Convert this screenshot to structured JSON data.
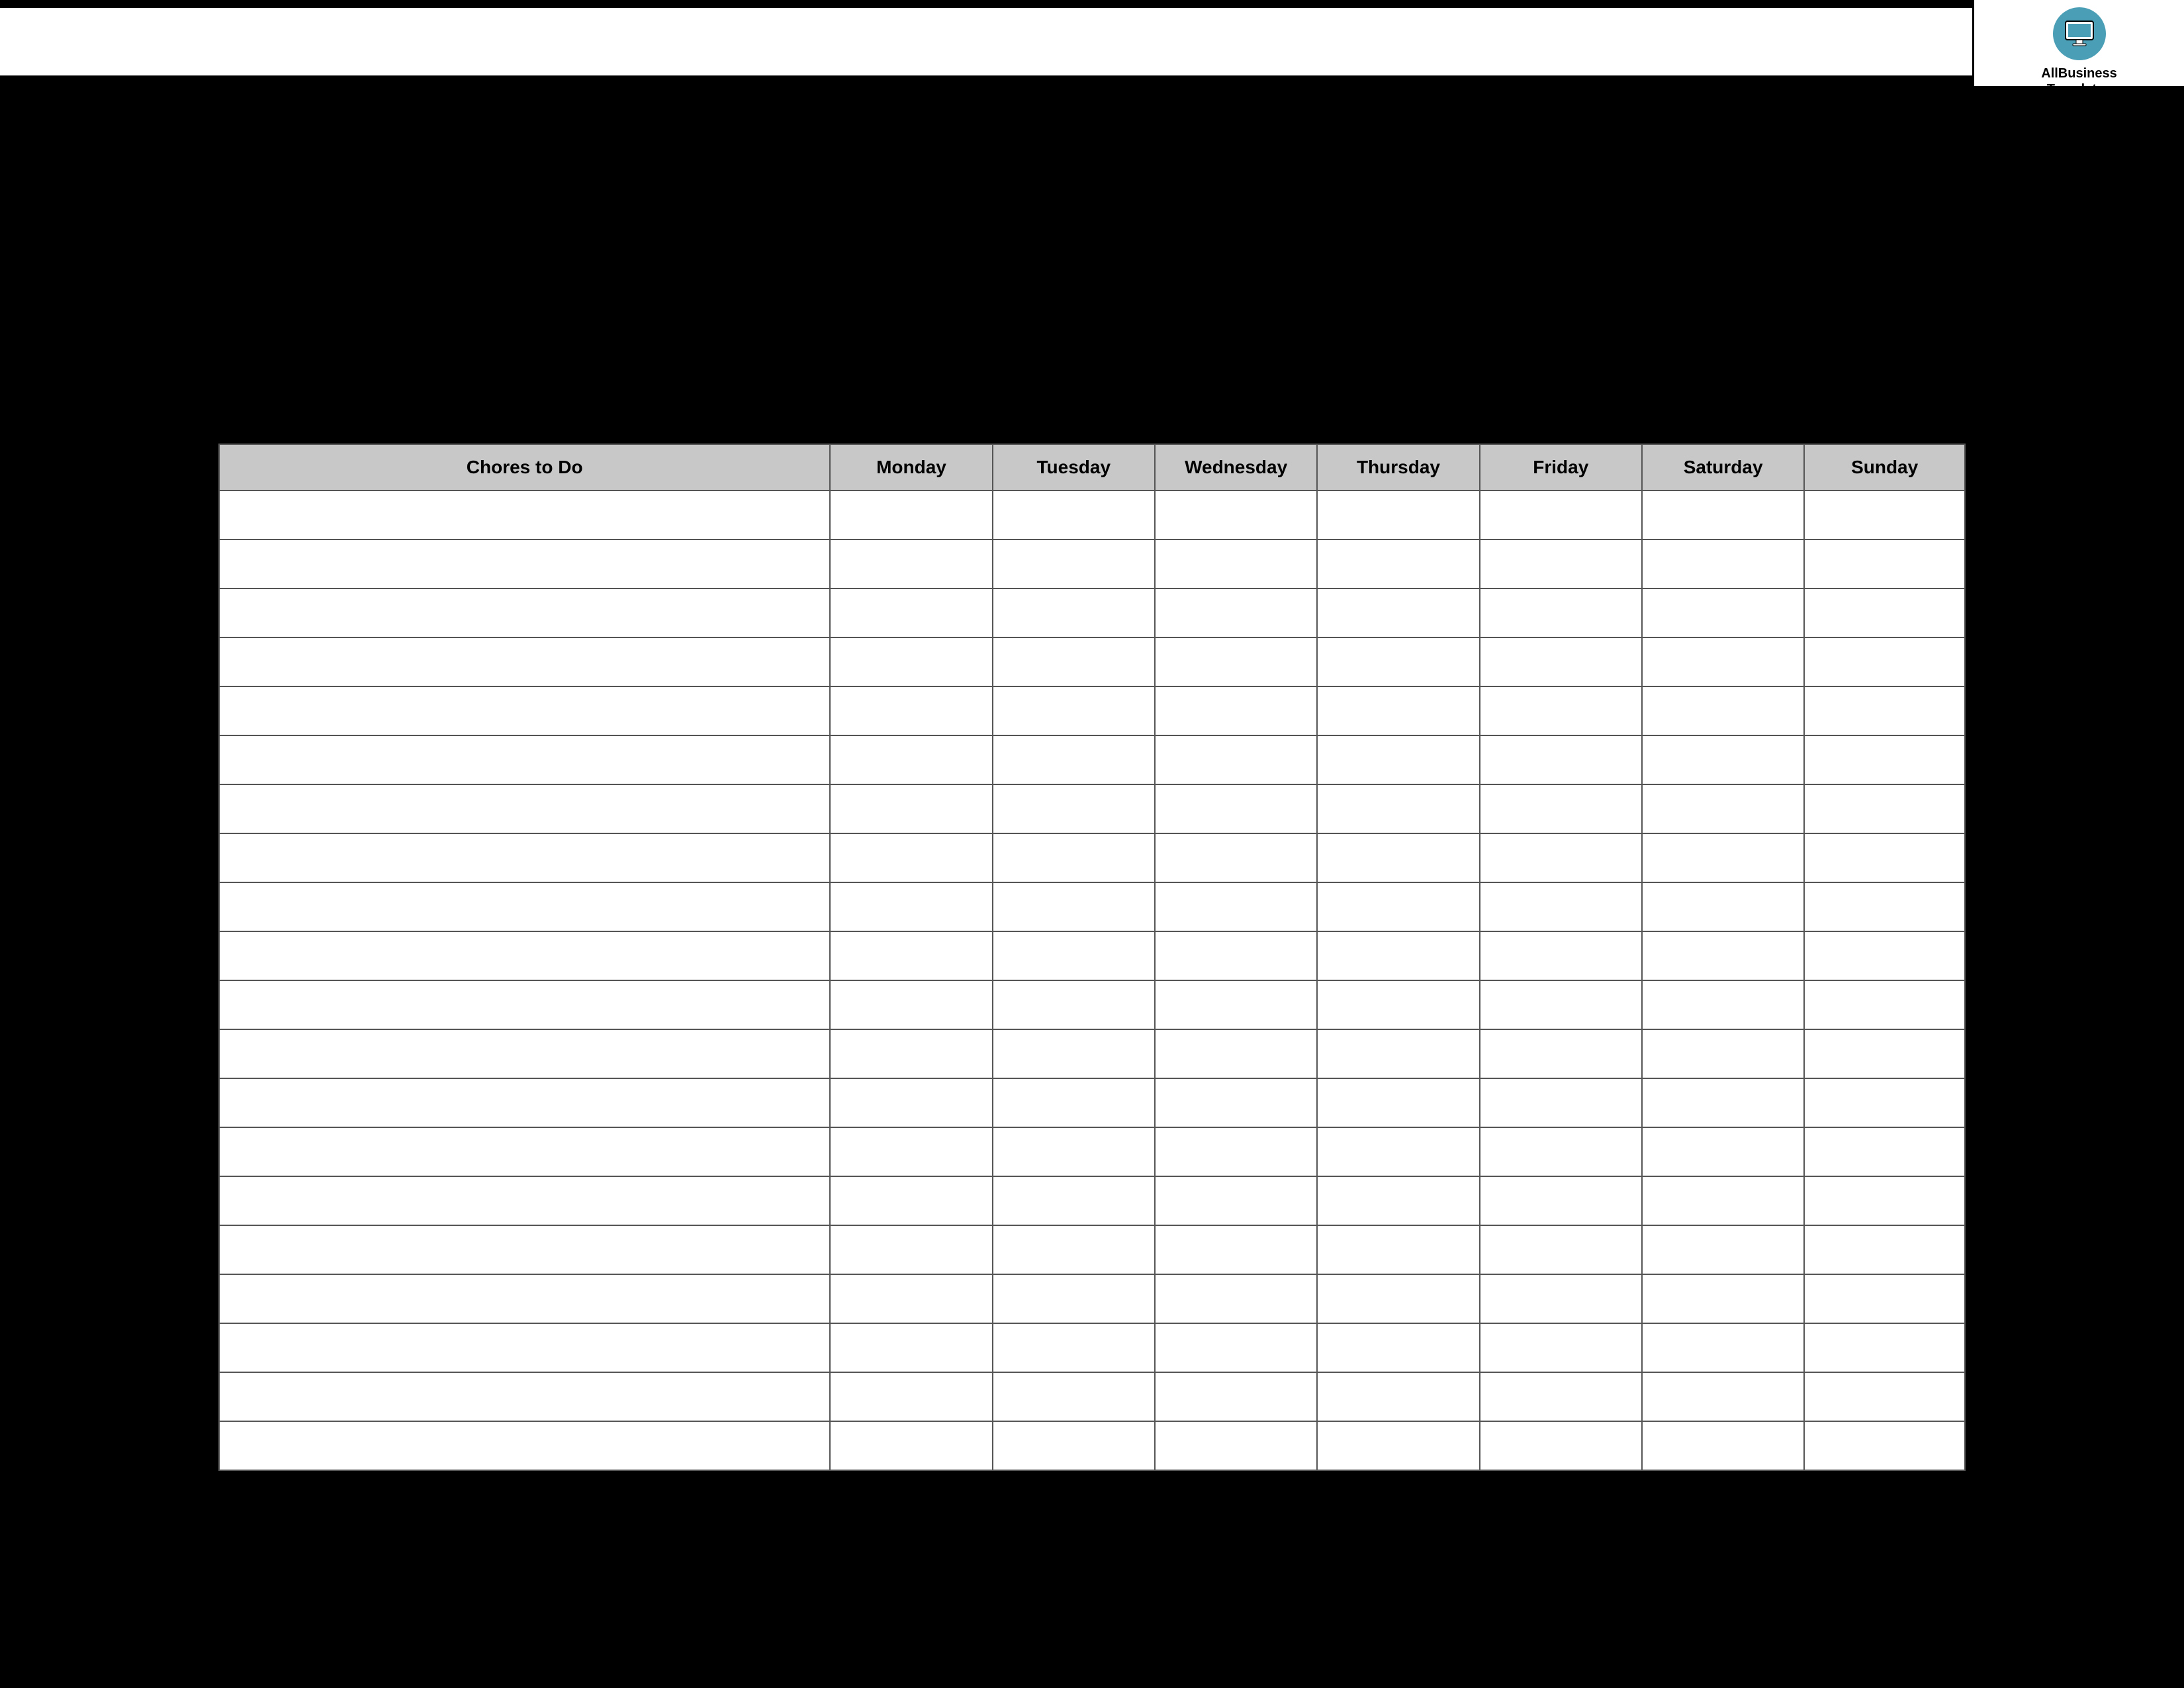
{
  "header": {
    "title": ""
  },
  "logo": {
    "name": "AllBusiness Templates",
    "line1": "AllBusiness",
    "line2": "Templates"
  },
  "table": {
    "columns": [
      {
        "key": "chores",
        "label": "Chores to Do"
      },
      {
        "key": "monday",
        "label": "Monday"
      },
      {
        "key": "tuesday",
        "label": "Tuesday"
      },
      {
        "key": "wednesday",
        "label": "Wednesday"
      },
      {
        "key": "thursday",
        "label": "Thursday"
      },
      {
        "key": "friday",
        "label": "Friday"
      },
      {
        "key": "saturday",
        "label": "Saturday"
      },
      {
        "key": "sunday",
        "label": "Sunday"
      }
    ],
    "empty_rows": 20
  }
}
